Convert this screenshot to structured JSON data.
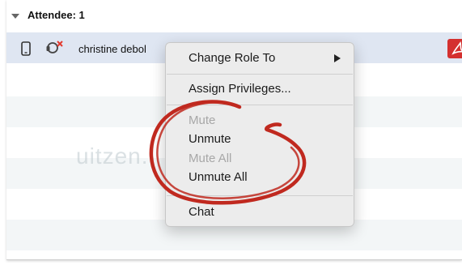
{
  "attendees": {
    "header_label": "Attendee: 1",
    "rows": [
      {
        "name": "christine debol"
      }
    ]
  },
  "context_menu": {
    "items": {
      "change_role": "Change Role To",
      "assign_privileges": "Assign Privileges...",
      "mute": "Mute",
      "unmute": "Unmute",
      "mute_all": "Mute All",
      "unmute_all": "Unmute All",
      "chat": "Chat"
    },
    "disabled_items": [
      "Mute",
      "Mute All"
    ]
  },
  "annotation": {
    "color": "#c0291f"
  },
  "colors": {
    "selected_row": "#dfe6f2",
    "alt_row": "#f3f6f7",
    "disabled_text": "#a7a7a7"
  },
  "icons": {
    "disclosure": "disclosure-triangle-icon",
    "phone": "phone-icon",
    "role": "presenter-role-icon",
    "pdf": "pdf-icon",
    "submenu": "submenu-arrow-icon"
  }
}
